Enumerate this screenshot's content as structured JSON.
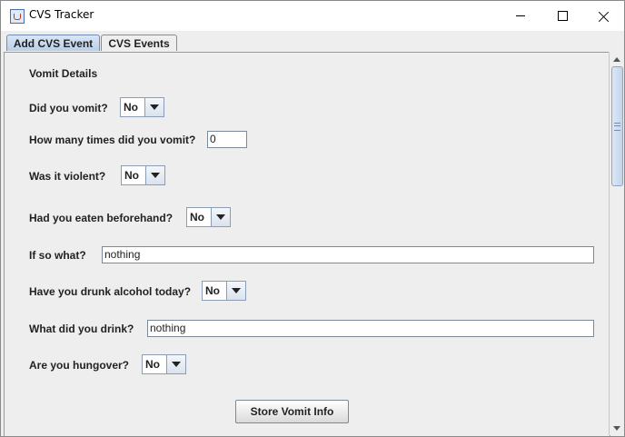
{
  "window": {
    "title": "CVS Tracker",
    "icon": "java-cup-icon"
  },
  "tabs": [
    {
      "label": "Add CVS Event",
      "active": true
    },
    {
      "label": "CVS Events",
      "active": false
    }
  ],
  "form": {
    "section_title": "Vomit Details",
    "vomit": {
      "label": "Did you vomit?",
      "value": "No"
    },
    "times": {
      "label": "How many times did you vomit?",
      "value": "0"
    },
    "violent": {
      "label": "Was it violent?",
      "value": "No"
    },
    "eaten": {
      "label": "Had you eaten beforehand?",
      "value": "No"
    },
    "food": {
      "label": "If so what?",
      "value": "nothing"
    },
    "alcohol": {
      "label": "Have you drunk alcohol today?",
      "value": "No"
    },
    "drink": {
      "label": "What did you drink?",
      "value": "nothing"
    },
    "hungover": {
      "label": "Are you hungover?",
      "value": "No"
    },
    "submit_label": "Store Vomit Info"
  },
  "colors": {
    "active_tab": "#b8cfe9",
    "panel_bg": "#eeeeee"
  }
}
